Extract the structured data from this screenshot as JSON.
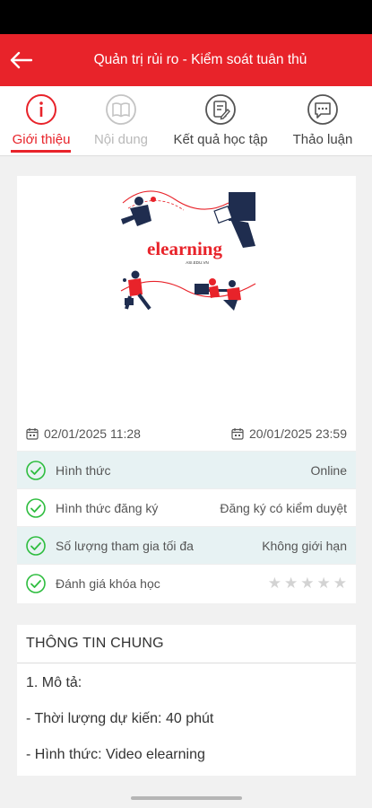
{
  "header": {
    "title": "Quản trị rủi ro - Kiểm soát tuân thủ"
  },
  "tabs": [
    {
      "label": "Giới thiệu",
      "icon": "info-icon",
      "state": "active"
    },
    {
      "label": "Nội dung",
      "icon": "book-icon",
      "state": "disabled"
    },
    {
      "label": "Kết quả học tập",
      "icon": "result-icon",
      "state": "normal"
    },
    {
      "label": "Thảo luận",
      "icon": "chat-icon",
      "state": "normal"
    }
  ],
  "banner": {
    "logo_text": "elearning",
    "sub_text": "ASI.EDU.VN"
  },
  "dates": {
    "start": "02/01/2025 11:28",
    "end": "20/01/2025 23:59"
  },
  "info": [
    {
      "label": "Hình thức",
      "value": "Online"
    },
    {
      "label": "Hình thức đăng ký",
      "value": "Đăng ký có kiểm duyệt"
    },
    {
      "label": "Số lượng tham gia tối đa",
      "value": "Không giới hạn"
    },
    {
      "label": "Đánh giá khóa học",
      "rating": 0,
      "max_rating": 5
    }
  ],
  "general": {
    "title": "THÔNG TIN CHUNG",
    "lines": [
      "1. Mô tả:",
      "- Thời lượng dự kiến: 40 phút",
      "- Hình thức: Video elearning"
    ]
  },
  "colors": {
    "brand": "#e8232a",
    "check": "#2ebd3f",
    "alt_row": "#e7f2f3"
  }
}
